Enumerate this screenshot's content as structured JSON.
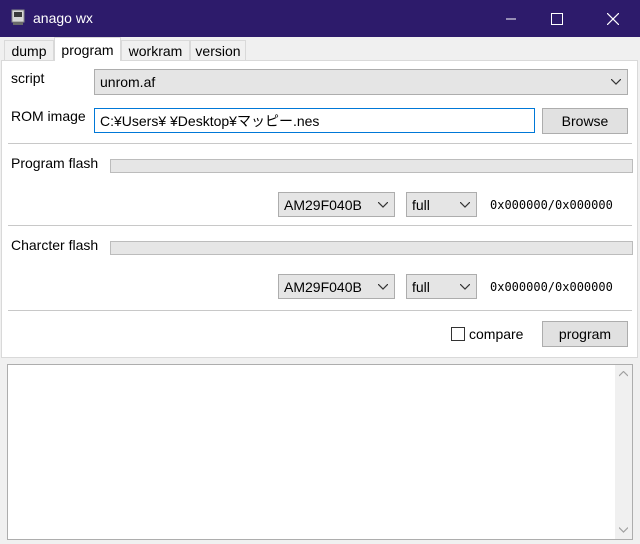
{
  "window": {
    "title": "anago wx"
  },
  "tabs": [
    {
      "label": "dump"
    },
    {
      "label": "program"
    },
    {
      "label": "workram"
    },
    {
      "label": "version"
    }
  ],
  "program": {
    "script_label": "script",
    "script_value": "unrom.af",
    "rom_label": "ROM image",
    "rom_value": "C:¥Users¥ ¥Desktop¥マッピー.nes",
    "browse_label": "Browse",
    "program_flash": {
      "label": "Program flash",
      "device": "AM29F040B",
      "mode": "full",
      "address": "0x000000/0x000000",
      "progress": 0
    },
    "character_flash": {
      "label": "Charcter flash",
      "device": "AM29F040B",
      "mode": "full",
      "address": "0x000000/0x000000",
      "progress": 0
    },
    "compare_label": "compare",
    "compare_checked": false,
    "program_button_label": "program"
  },
  "log": {
    "text": ""
  },
  "colors": {
    "titlebar": "#2d1b6b",
    "focus_border": "#0078d7"
  }
}
